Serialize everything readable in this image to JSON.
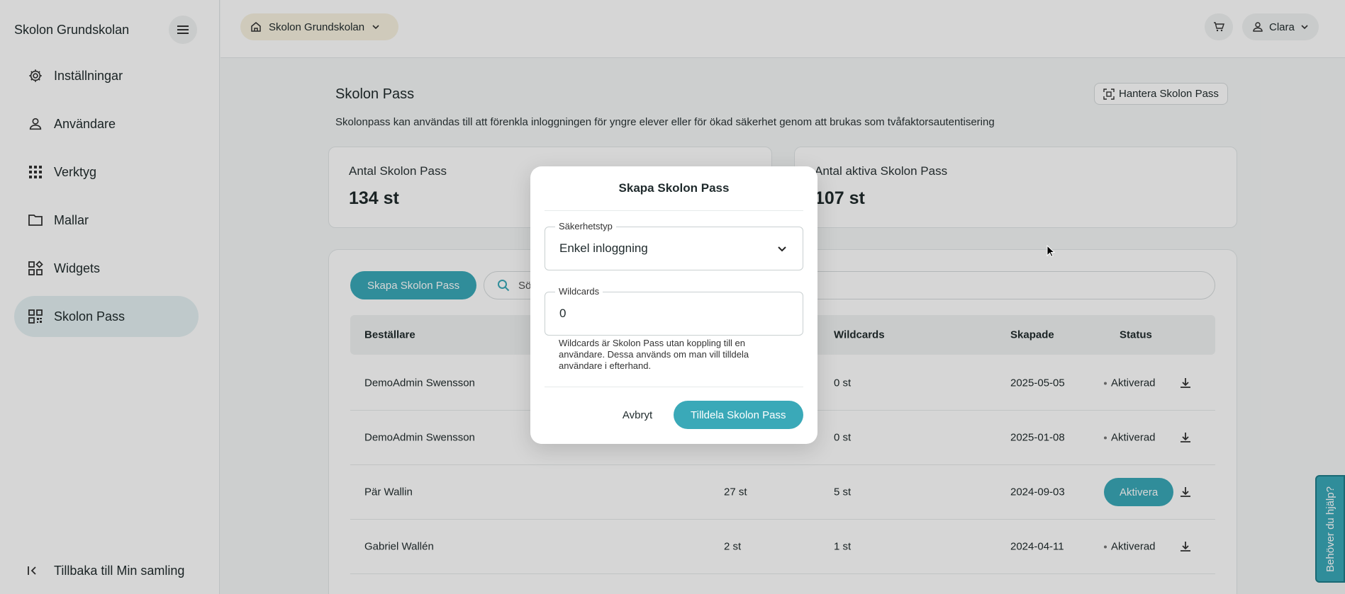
{
  "sidebar": {
    "title": "Skolon Grundskolan",
    "items": [
      {
        "label": "Inställningar",
        "icon": "gear-icon"
      },
      {
        "label": "Användare",
        "icon": "user-icon"
      },
      {
        "label": "Verktyg",
        "icon": "grid-icon"
      },
      {
        "label": "Mallar",
        "icon": "folder-icon"
      },
      {
        "label": "Widgets",
        "icon": "widgets-icon"
      },
      {
        "label": "Skolon Pass",
        "icon": "qr-icon",
        "active": true
      }
    ],
    "back_label": "Tillbaka till Min samling"
  },
  "topbar": {
    "school": "Skolon Grundskolan",
    "user": "Clara"
  },
  "main": {
    "title": "Skolon Pass",
    "manage_label": "Hantera Skolon Pass",
    "description": "Skolonpass kan användas till att förenkla inloggningen för yngre elever eller för ökad säkerhet genom att brukas som tvåfaktorsautentisering",
    "stats": [
      {
        "label": "Antal Skolon Pass",
        "value": "134 st"
      },
      {
        "label": "Antal aktiva Skolon Pass",
        "value": "107 st"
      }
    ],
    "create_label": "Skapa Skolon Pass",
    "search_placeholder": "Sö",
    "columns": [
      "Beställare",
      "Wildcards",
      "Skapade",
      "Status"
    ],
    "rows": [
      {
        "orderer": "DemoAdmin Swensson",
        "count": "",
        "wildcards": "0 st",
        "created": "2025-05-05",
        "status": "Aktiverad",
        "action": null
      },
      {
        "orderer": "DemoAdmin Swensson",
        "count": "",
        "wildcards": "0 st",
        "created": "2025-01-08",
        "status": "Aktiverad",
        "action": null
      },
      {
        "orderer": "Pär Wallin",
        "count": "27 st",
        "wildcards": "5 st",
        "created": "2024-09-03",
        "status": "",
        "action": "Aktivera"
      },
      {
        "orderer": "Gabriel Wallén",
        "count": "2 st",
        "wildcards": "1 st",
        "created": "2024-04-11",
        "status": "Aktiverad",
        "action": null
      }
    ]
  },
  "modal": {
    "title": "Skapa Skolon Pass",
    "security_label": "Säkerhetstyp",
    "security_value": "Enkel inloggning",
    "wildcards_label": "Wildcards",
    "wildcards_value": "0",
    "hint": "Wildcards är Skolon Pass utan koppling till en användare. Dessa används om man vill tilldela användare i efterhand.",
    "cancel_label": "Avbryt",
    "assign_label": "Tilldela Skolon Pass"
  },
  "help_label": "Behöver du hjälp?",
  "colors": {
    "accent": "#3aa9b8",
    "active_nav": "#e4f0f2",
    "school_chip": "#f7f1df"
  }
}
